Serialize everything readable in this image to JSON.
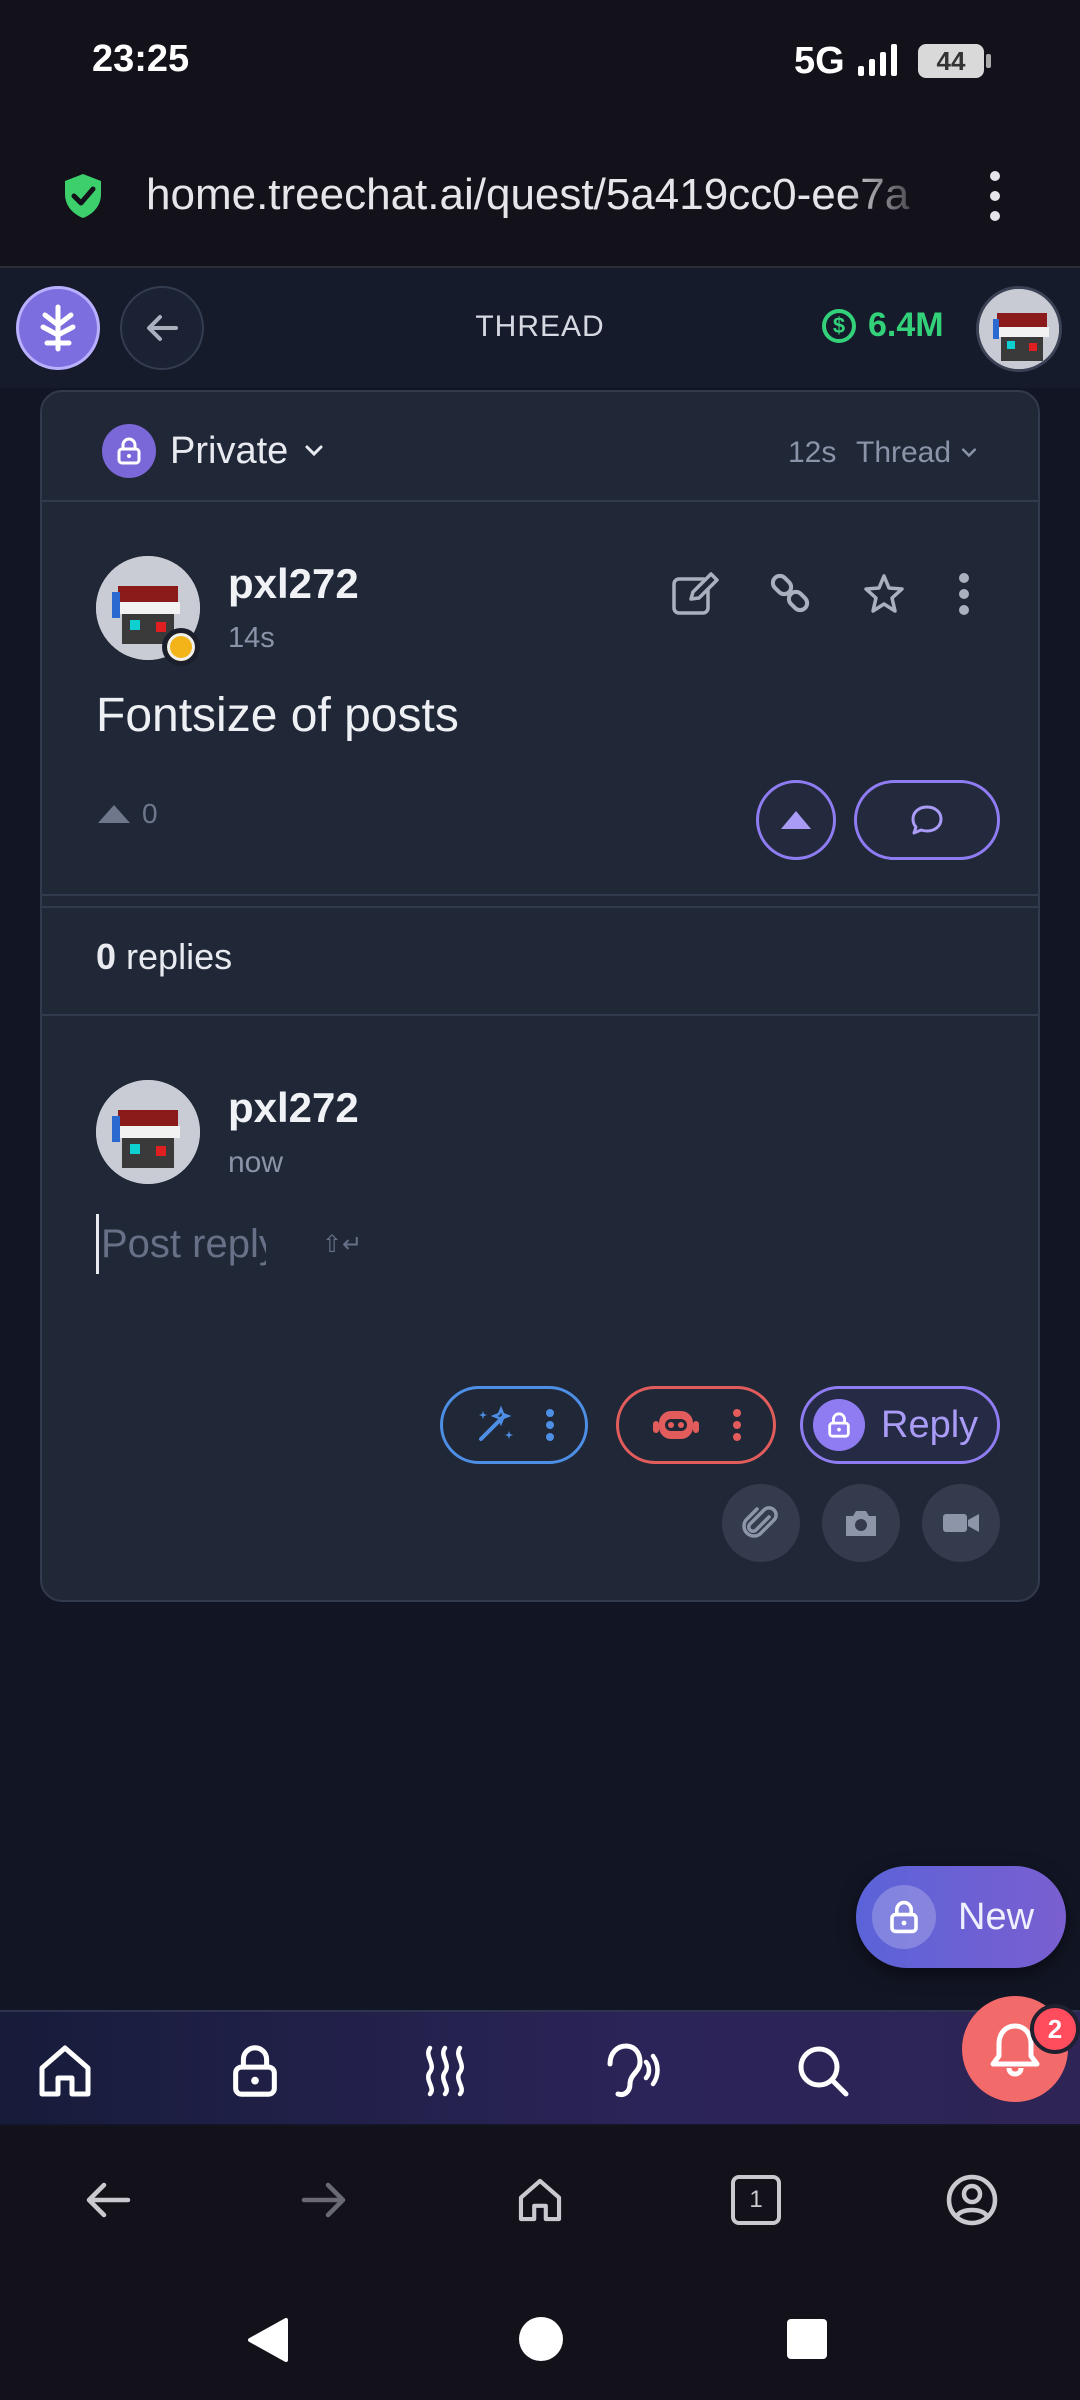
{
  "status_bar": {
    "time": "23:25",
    "network": "5G",
    "battery": "44"
  },
  "browser": {
    "url": "home.treechat.ai/quest/5a419cc0-ee7a"
  },
  "header": {
    "title": "THREAD",
    "balance": "6.4M"
  },
  "thread": {
    "privacy_label": "Private",
    "age": "12s",
    "mode_label": "Thread"
  },
  "post": {
    "username": "pxl272",
    "time": "14s",
    "body": "Fontsize of posts",
    "vote_count": "0"
  },
  "replies": {
    "count": "0",
    "label": "replies"
  },
  "composer": {
    "username": "pxl272",
    "time": "now",
    "placeholder": "Post reply...",
    "hint": "⇧↵",
    "reply_label": "Reply"
  },
  "fab": {
    "label": "New"
  },
  "notifications": {
    "badge": "2"
  },
  "browser_nav": {
    "tab_count": "1"
  },
  "colors": {
    "accent": "#8f7cf3",
    "balance": "#33d17a",
    "danger": "#e25c5c",
    "ai": "#4e8fe6",
    "notification": "#f26a6a"
  }
}
